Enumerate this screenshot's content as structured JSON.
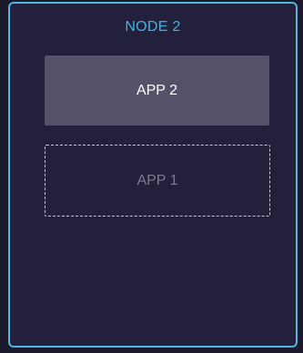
{
  "node": {
    "title": "NODE 2",
    "border_color": "#4fb3e3",
    "title_color": "#3fb4ea"
  },
  "apps": {
    "placed": {
      "label": "APP 2",
      "style": "solid"
    },
    "placeholder": {
      "label": "APP 1",
      "style": "dashed"
    }
  }
}
